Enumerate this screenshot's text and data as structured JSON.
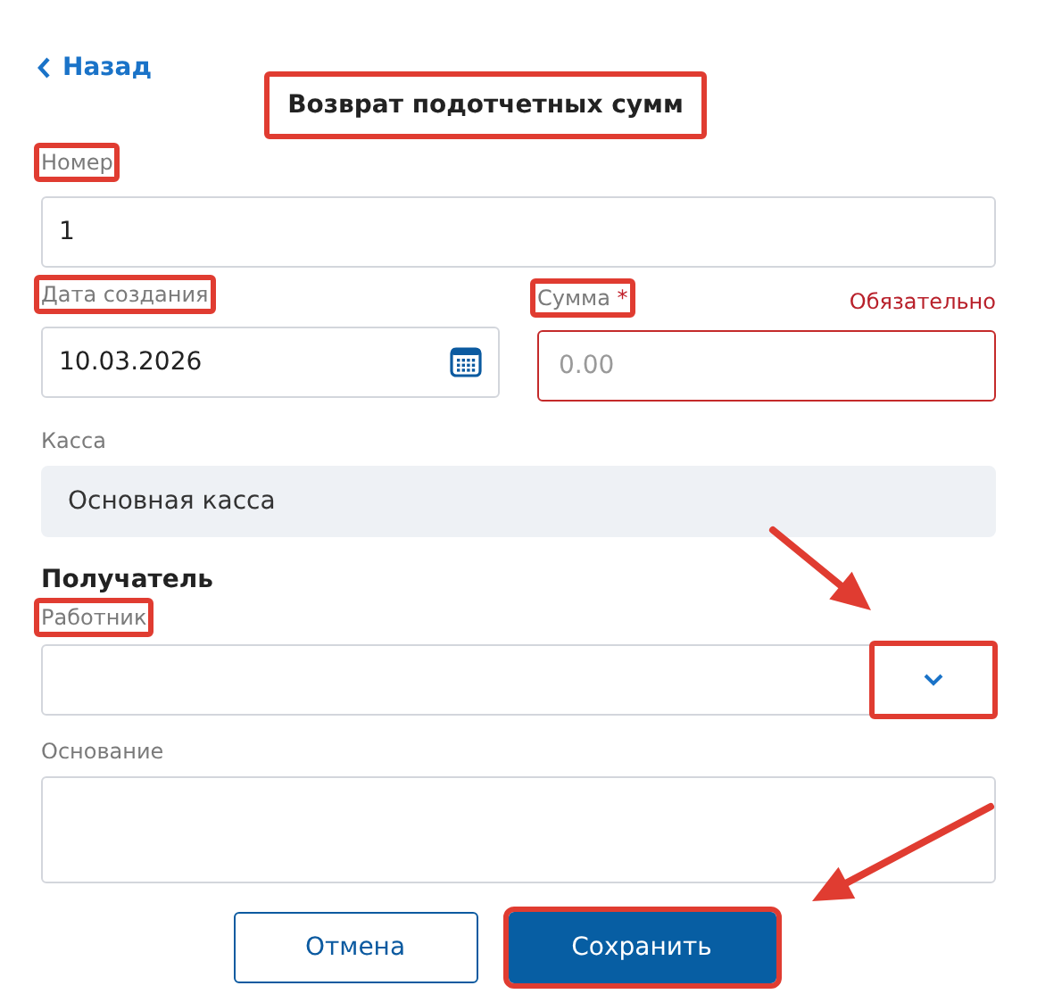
{
  "back_link": {
    "label": "Назад"
  },
  "title": {
    "text": "Возврат подотчетных сумм",
    "highlighted": true
  },
  "number": {
    "label": "Номер",
    "value": "1",
    "highlighted": true
  },
  "date": {
    "label": "Дата создания",
    "value": "10.03.2026",
    "highlighted": true
  },
  "amount": {
    "label": "Сумма",
    "required_mark": "*",
    "error": "Обязательно",
    "placeholder": "0.00",
    "invalid": true,
    "highlighted": true
  },
  "cash_desk": {
    "label": "Касса",
    "value": "Основная касса",
    "disabled": true,
    "highlighted": false
  },
  "recipient": {
    "heading": "Получатель"
  },
  "employee": {
    "label": "Работник",
    "highlighted": true,
    "toggle_highlighted": true
  },
  "basis": {
    "label": "Основание",
    "highlighted": false
  },
  "buttons": [
    {
      "kind": "secondary",
      "label": "Отмена",
      "highlighted": false
    },
    {
      "kind": "primary",
      "label": "Сохранить",
      "highlighted": true
    }
  ]
}
